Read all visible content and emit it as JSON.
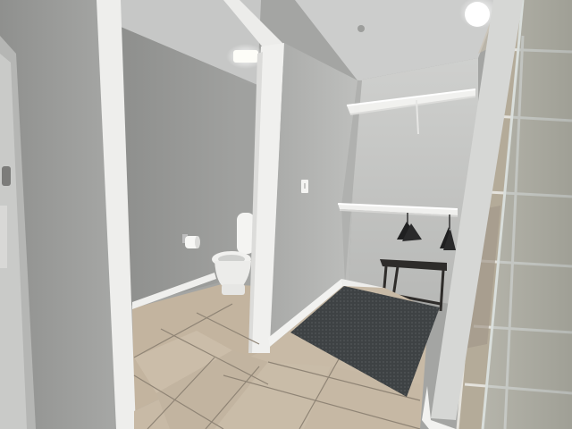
{
  "scene": {
    "kind": "photo",
    "subject": "bathroom-with-walk-in-closet"
  },
  "colors": {
    "wall_gray": "#9b9c9a",
    "wall_light": "#c2c4c2",
    "ceiling": "#c9cac9",
    "trim_white": "#f2f2f0",
    "floor_tile": "#c7b9a4",
    "floor_grout": "#8f8475",
    "rug": "#3e4244",
    "shower_tile": "#b1a896",
    "glass": "#a9b0ad"
  },
  "icons": {
    "ceiling_light": "light-fixture-icon",
    "toilet": "toilet-icon",
    "toilet_paper": "toilet-paper-icon",
    "light_switch": "switch-icon"
  }
}
